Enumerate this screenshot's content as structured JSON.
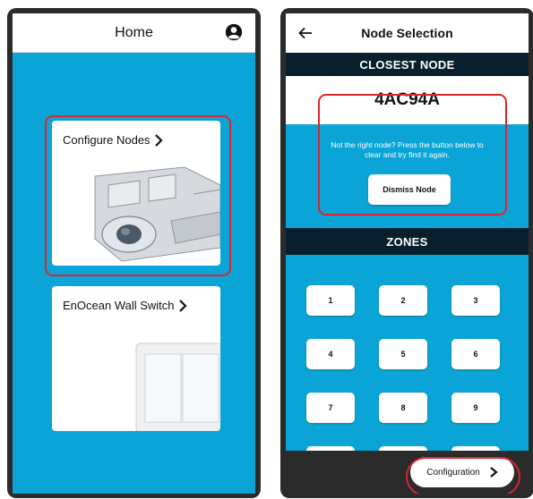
{
  "home": {
    "title": "Home",
    "account_icon": "account-circle-icon",
    "cards": [
      {
        "label": "Configure Nodes",
        "icon": "chevron-right-icon"
      },
      {
        "label": "EnOcean Wall Switch",
        "icon": "chevron-right-icon"
      }
    ]
  },
  "node_selection": {
    "title": "Node Selection",
    "back_icon": "arrow-left-icon",
    "closest_label": "CLOSEST NODE",
    "node_id": "4AC94A",
    "hint": "Not the right node? Press the button below to clear and try find it again.",
    "dismiss_label": "Dismiss Node",
    "zones_label": "ZONES",
    "zones": [
      "1",
      "2",
      "3",
      "4",
      "5",
      "6",
      "7",
      "8",
      "9"
    ],
    "config_label": "Configuration",
    "config_icon": "chevron-right-icon"
  },
  "colors": {
    "screen_bg": "#0aa5d6",
    "band_bg": "#08202d",
    "frame": "#2b2b2b",
    "highlight": "#d8262e"
  }
}
